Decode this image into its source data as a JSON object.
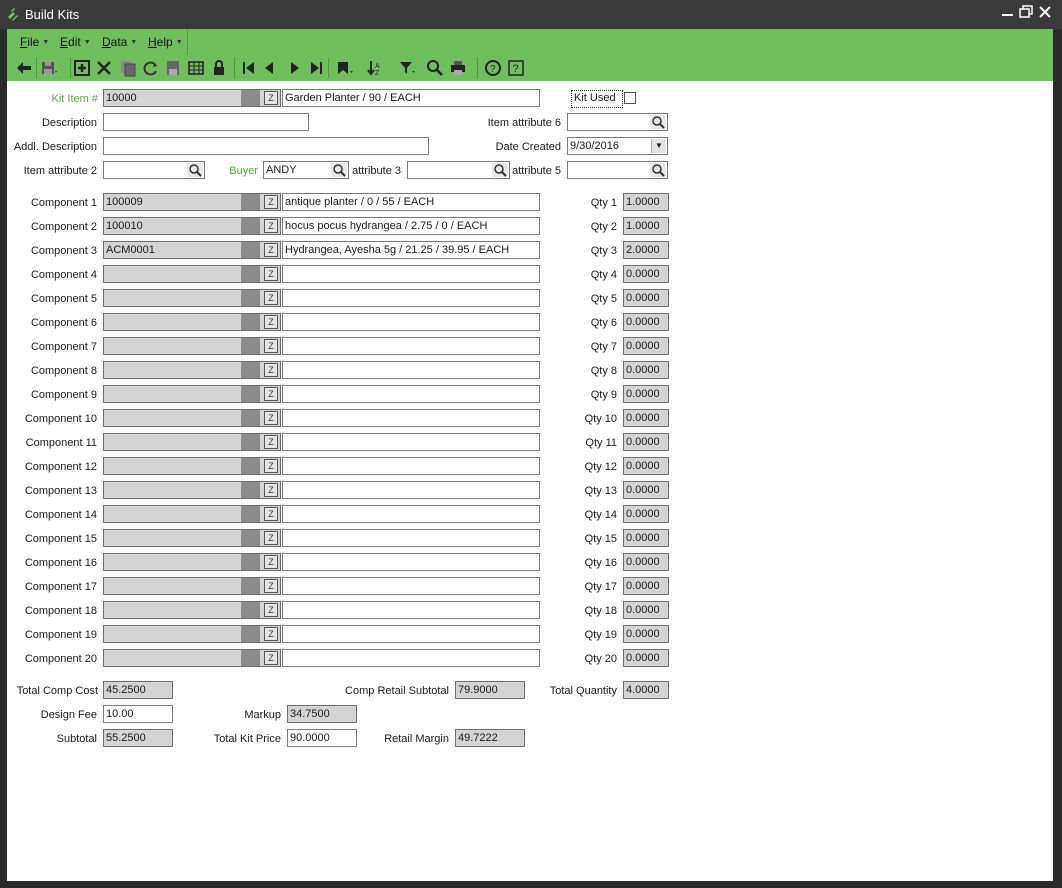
{
  "window": {
    "title": "Build Kits"
  },
  "menu": [
    {
      "label": "File",
      "ul": "F",
      "rest": "ile"
    },
    {
      "label": "Edit",
      "ul": "E",
      "rest": "dit"
    },
    {
      "label": "Data",
      "ul": "D",
      "rest": "ata"
    },
    {
      "label": "Help",
      "ul": "H",
      "rest": "elp"
    }
  ],
  "toolbar_icons": [
    "back-arrow-icon",
    "save-icon",
    "add-icon",
    "delete-icon",
    "copy-icon",
    "refresh-icon",
    "save-all-icon",
    "grid-icon",
    "lock-icon",
    "first-record-icon",
    "previous-record-icon",
    "next-record-icon",
    "last-record-icon",
    "bookmark-icon",
    "sort-icon",
    "filter-icon",
    "search-icon",
    "print-icon",
    "support-icon",
    "help-icon"
  ],
  "header": {
    "kit_item_label": "Kit Item #",
    "kit_item_value": "10000",
    "kit_item_desc": "Garden Planter / 90 / EACH",
    "kit_used_label": "Kit Used",
    "description_label": "Description",
    "description_value": "",
    "addl_description_label": "Addl. Description",
    "addl_description_value": "",
    "item_attr6_label": "Item attribute 6",
    "item_attr6_value": "",
    "date_created_label": "Date Created",
    "date_created_value": "9/30/2016",
    "item_attr2_label": "Item attribute 2",
    "item_attr2_value": "",
    "buyer_label": "Buyer",
    "buyer_value": "ANDY",
    "attr3_label": "attribute 3",
    "attr3_value": "",
    "attr5_label": "attribute 5",
    "attr5_value": ""
  },
  "components": [
    {
      "label": "Component 1",
      "code": "100009",
      "desc": "antique planter / 0 / 55 / EACH",
      "qty_label": "Qty 1",
      "qty": "1.0000"
    },
    {
      "label": "Component 2",
      "code": "100010",
      "desc": "hocus pocus hydrangea / 2.75 / 0 / EACH",
      "qty_label": "Qty 2",
      "qty": "1.0000"
    },
    {
      "label": "Component 3",
      "code": "ACM0001",
      "desc": "Hydrangea, Ayesha  5g / 21.25 / 39.95 / EACH",
      "qty_label": "Qty 3",
      "qty": "2.0000"
    },
    {
      "label": "Component 4",
      "code": "",
      "desc": "",
      "qty_label": "Qty 4",
      "qty": "0.0000"
    },
    {
      "label": "Component 5",
      "code": "",
      "desc": "",
      "qty_label": "Qty 5",
      "qty": "0.0000"
    },
    {
      "label": "Component 6",
      "code": "",
      "desc": "",
      "qty_label": "Qty 6",
      "qty": "0.0000"
    },
    {
      "label": "Component 7",
      "code": "",
      "desc": "",
      "qty_label": "Qty 7",
      "qty": "0.0000"
    },
    {
      "label": "Component 8",
      "code": "",
      "desc": "",
      "qty_label": "Qty 8",
      "qty": "0.0000"
    },
    {
      "label": "Component 9",
      "code": "",
      "desc": "",
      "qty_label": "Qty 9",
      "qty": "0.0000"
    },
    {
      "label": "Component 10",
      "code": "",
      "desc": "",
      "qty_label": "Qty 10",
      "qty": "0.0000"
    },
    {
      "label": "Component 11",
      "code": "",
      "desc": "",
      "qty_label": "Qty 11",
      "qty": "0.0000"
    },
    {
      "label": "Component 12",
      "code": "",
      "desc": "",
      "qty_label": "Qty 12",
      "qty": "0.0000"
    },
    {
      "label": "Component 13",
      "code": "",
      "desc": "",
      "qty_label": "Qty 13",
      "qty": "0.0000"
    },
    {
      "label": "Component 14",
      "code": "",
      "desc": "",
      "qty_label": "Qty 14",
      "qty": "0.0000"
    },
    {
      "label": "Component 15",
      "code": "",
      "desc": "",
      "qty_label": "Qty 15",
      "qty": "0.0000"
    },
    {
      "label": "Component 16",
      "code": "",
      "desc": "",
      "qty_label": "Qty 16",
      "qty": "0.0000"
    },
    {
      "label": "Component 17",
      "code": "",
      "desc": "",
      "qty_label": "Qty 17",
      "qty": "0.0000"
    },
    {
      "label": "Component 18",
      "code": "",
      "desc": "",
      "qty_label": "Qty 18",
      "qty": "0.0000"
    },
    {
      "label": "Component 19",
      "code": "",
      "desc": "",
      "qty_label": "Qty 19",
      "qty": "0.0000"
    },
    {
      "label": "Component 20",
      "code": "",
      "desc": "",
      "qty_label": "Qty 20",
      "qty": "0.0000"
    }
  ],
  "totals": {
    "total_comp_cost_label": "Total Comp Cost",
    "total_comp_cost": "45.2500",
    "comp_retail_subtotal_label": "Comp Retail Subtotal",
    "comp_retail_subtotal": "79.9000",
    "total_quantity_label": "Total Quantity",
    "total_quantity": "4.0000",
    "design_fee_label": "Design Fee",
    "design_fee": "10.00",
    "markup_label": "Markup",
    "markup": "34.7500",
    "subtotal_label": "Subtotal",
    "subtotal": "55.2500",
    "total_kit_price_label": "Total Kit Price",
    "total_kit_price": "90.0000",
    "retail_margin_label": "Retail Margin",
    "retail_margin": "49.7222"
  }
}
